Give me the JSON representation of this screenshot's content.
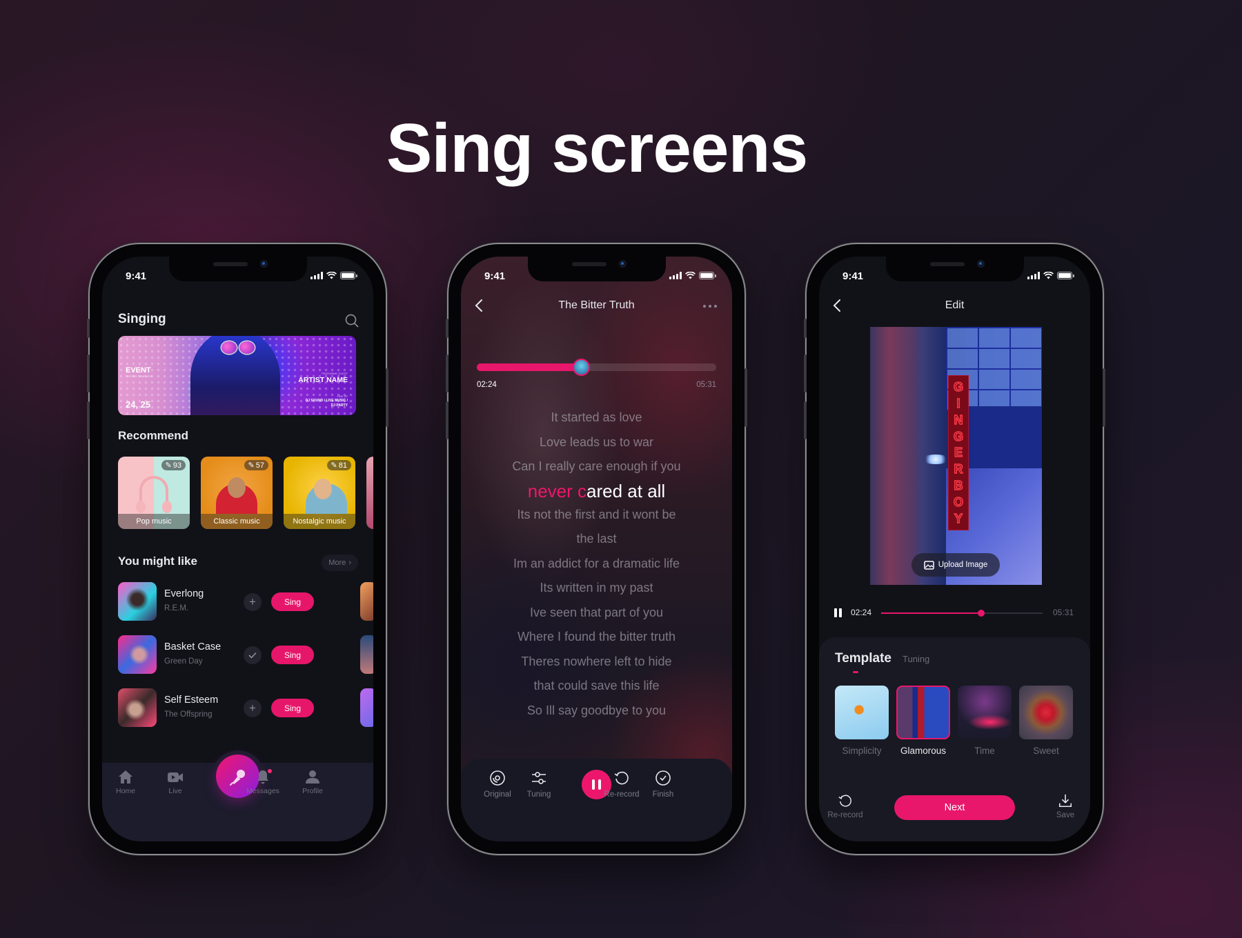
{
  "page": {
    "title": "Sing screens"
  },
  "status_bar": {
    "time": "9:41"
  },
  "screen_singing": {
    "title": "Singing",
    "banner": {
      "event_title": "EVENT",
      "event_subtitle": "POSTER TEMPLATE",
      "dates": "24, 25",
      "featuring_label": "FEATURING GUEST",
      "artist": "ARTIST NAME",
      "lineup_label": "LINE UP",
      "lineup_1": "DJ SOUND / LIVE MUSIC /",
      "lineup_2": "DJ PARTY"
    },
    "recommend": {
      "heading": "Recommend",
      "cards": [
        {
          "label": "Pop music",
          "count": "93"
        },
        {
          "label": "Classic music",
          "count": "57"
        },
        {
          "label": "Nostalgic music",
          "count": "81"
        }
      ]
    },
    "you_might_like": {
      "heading": "You might like",
      "more_label": "More",
      "songs": [
        {
          "title": "Everlong",
          "artist": "R.E.M.",
          "action": "add",
          "sing_label": "Sing"
        },
        {
          "title": "Basket Case",
          "artist": "Green Day",
          "action": "added",
          "sing_label": "Sing"
        },
        {
          "title": "Self Esteem",
          "artist": "The Offspring",
          "action": "add",
          "sing_label": "Sing"
        }
      ]
    },
    "nav": [
      {
        "label": "Home",
        "icon": "home-icon"
      },
      {
        "label": "Live",
        "icon": "video-icon"
      },
      {
        "label": "",
        "icon": "microphone-icon"
      },
      {
        "label": "Messages",
        "icon": "bell-icon",
        "has_badge": true
      },
      {
        "label": "Profile",
        "icon": "user-icon"
      }
    ]
  },
  "screen_lyrics": {
    "title": "The Bitter Truth",
    "elapsed": "02:24",
    "total": "05:31",
    "progress_fraction": 0.435,
    "lyrics_before": [
      "It started as love",
      "Love leads us to war",
      "Can I really care enough if you"
    ],
    "current_line": {
      "sung": "never c",
      "unsung": "ared at all"
    },
    "lyrics_after": [
      "Its not the first and it wont be",
      "the last",
      "Im an addict for a dramatic life",
      "Its written in my past",
      "Ive seen that part of you",
      "Where I found the bitter truth",
      "Theres nowhere left to hide",
      "that could save this life",
      "So Ill say goodbye to you"
    ],
    "controls": [
      {
        "label": "Original",
        "icon": "disc-icon"
      },
      {
        "label": "Tuning",
        "icon": "sliders-icon"
      },
      {
        "label": "",
        "icon": "pause-icon"
      },
      {
        "label": "Re-record",
        "icon": "rerecord-icon"
      },
      {
        "label": "Finish",
        "icon": "check-circle-icon"
      }
    ],
    "accent": "#E8176B"
  },
  "screen_edit": {
    "title": "Edit",
    "cover_sign_text": "GINGERBOY",
    "upload_label": "Upload Image",
    "elapsed": "02:24",
    "total": "05:31",
    "progress_fraction": 0.62,
    "tabs": [
      {
        "label": "Template",
        "active": true
      },
      {
        "label": "Tuning",
        "active": false
      }
    ],
    "templates": [
      {
        "name": "Simplicity",
        "selected": false
      },
      {
        "name": "Glamorous",
        "selected": true
      },
      {
        "name": "Time",
        "selected": false
      },
      {
        "name": "Sweet",
        "selected": false
      }
    ],
    "rerecord_label": "Re-record",
    "next_label": "Next",
    "save_label": "Save"
  }
}
